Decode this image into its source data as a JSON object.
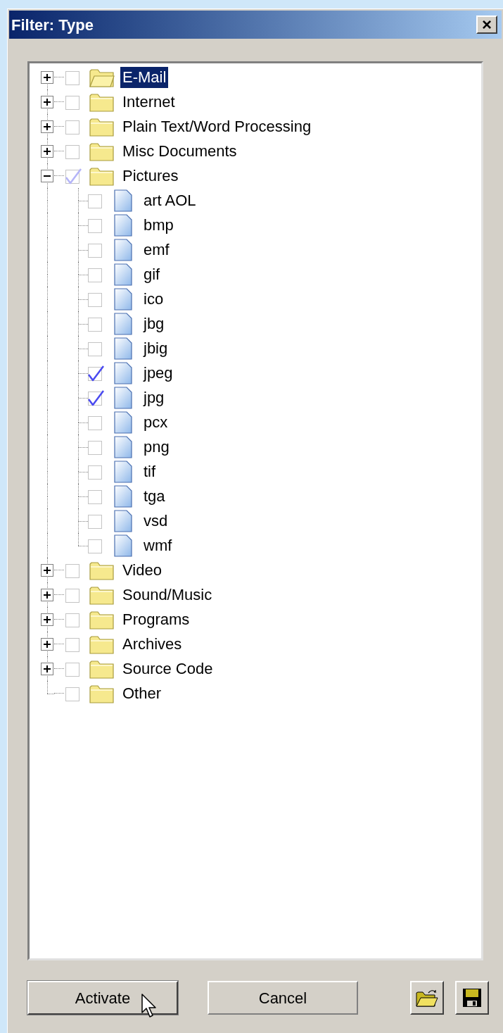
{
  "window": {
    "title": "Filter: Type",
    "close_label": "×"
  },
  "tree": [
    {
      "label": "E-Mail",
      "checked": false,
      "partial": false,
      "expanded": false,
      "selected": true
    },
    {
      "label": "Internet",
      "checked": false,
      "partial": false,
      "expanded": false,
      "selected": false
    },
    {
      "label": "Plain Text/Word Processing",
      "checked": false,
      "partial": false,
      "expanded": false,
      "selected": false
    },
    {
      "label": "Misc Documents",
      "checked": false,
      "partial": false,
      "expanded": false,
      "selected": false
    },
    {
      "label": "Pictures",
      "checked": false,
      "partial": true,
      "expanded": true,
      "selected": false,
      "children": [
        {
          "label": "art AOL",
          "checked": false
        },
        {
          "label": "bmp",
          "checked": false
        },
        {
          "label": "emf",
          "checked": false
        },
        {
          "label": "gif",
          "checked": false
        },
        {
          "label": "ico",
          "checked": false
        },
        {
          "label": "jbg",
          "checked": false
        },
        {
          "label": "jbig",
          "checked": false
        },
        {
          "label": "jpeg",
          "checked": true
        },
        {
          "label": "jpg",
          "checked": true
        },
        {
          "label": "pcx",
          "checked": false
        },
        {
          "label": "png",
          "checked": false
        },
        {
          "label": "tif",
          "checked": false
        },
        {
          "label": "tga",
          "checked": false
        },
        {
          "label": "vsd",
          "checked": false
        },
        {
          "label": "wmf",
          "checked": false
        }
      ]
    },
    {
      "label": "Video",
      "checked": false,
      "partial": false,
      "expanded": false,
      "selected": false
    },
    {
      "label": "Sound/Music",
      "checked": false,
      "partial": false,
      "expanded": false,
      "selected": false
    },
    {
      "label": "Programs",
      "checked": false,
      "partial": false,
      "expanded": false,
      "selected": false
    },
    {
      "label": "Archives",
      "checked": false,
      "partial": false,
      "expanded": false,
      "selected": false
    },
    {
      "label": "Source Code",
      "checked": false,
      "partial": false,
      "expanded": false,
      "selected": false
    },
    {
      "label": "Other",
      "checked": false,
      "partial": false,
      "selected": false
    }
  ],
  "buttons": [
    {
      "label": "Activate",
      "hovered": true
    },
    {
      "label": "Cancel",
      "hovered": false
    }
  ]
}
